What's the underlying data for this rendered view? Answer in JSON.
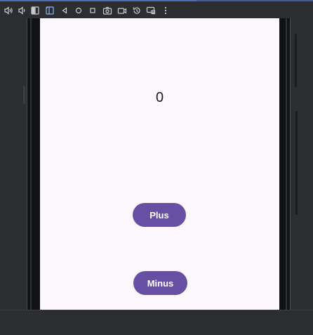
{
  "toolbar": {
    "buttons": [
      {
        "icon": "volume-up-icon"
      },
      {
        "icon": "volume-down-icon"
      },
      {
        "icon": "rotate-left-icon"
      },
      {
        "icon": "rotate-right-icon"
      },
      {
        "icon": "back-icon"
      },
      {
        "icon": "home-icon"
      },
      {
        "icon": "overview-icon"
      },
      {
        "icon": "camera-icon"
      },
      {
        "icon": "screen-record-icon"
      },
      {
        "icon": "snapshots-icon"
      },
      {
        "icon": "mirror-display-icon"
      },
      {
        "icon": "more-options-icon"
      }
    ],
    "accent_color": "#4a6fb5"
  },
  "app": {
    "counter_value": "0",
    "plus_label": "Plus",
    "minus_label": "Minus",
    "button_color": "#6750a4",
    "background_color": "#fdf7fe"
  }
}
